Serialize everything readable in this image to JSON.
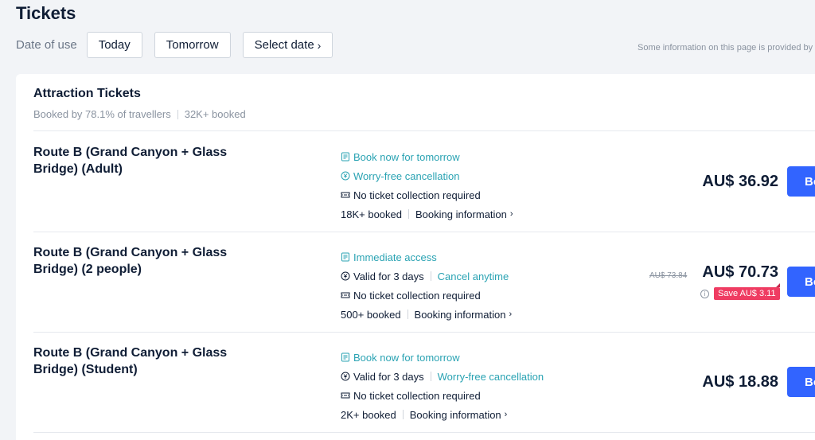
{
  "page": {
    "title": "Tickets",
    "date_label": "Date of use",
    "date_buttons": [
      {
        "label": "Today"
      },
      {
        "label": "Tomorrow"
      },
      {
        "label": "Select date"
      }
    ],
    "notice": "Some information on this page is provided by"
  },
  "card": {
    "title": "Attraction Tickets",
    "booked_by": "Booked by 78.1% of travellers",
    "booked_count": "32K+ booked"
  },
  "tickets": [
    {
      "name": "Route B (Grand Canyon + Glass Bridge) (Adult)",
      "feature1": "Book now for tomorrow",
      "feature2": "Worry-free cancellation",
      "feature3": "No ticket collection required",
      "booked": "18K+ booked",
      "booking_info": "Booking information",
      "price": "AU$ 36.92",
      "book_label": "Book"
    },
    {
      "name": "Route B (Grand Canyon + Glass Bridge) (2 people)",
      "feature1": "Immediate access",
      "validity": "Valid for 3 days",
      "cancel": "Cancel anytime",
      "feature3": "No ticket collection required",
      "booked": "500+ booked",
      "booking_info": "Booking information",
      "original_price": "AU$ 73.84",
      "price": "AU$ 70.73",
      "save": "Save AU$ 3.11",
      "book_label": "Book"
    },
    {
      "name": "Route B (Grand Canyon + Glass Bridge) (Student)",
      "feature1": "Book now for tomorrow",
      "validity": "Valid for 3 days",
      "cancel": "Worry-free cancellation",
      "feature3": "No ticket collection required",
      "booked": "2K+ booked",
      "booking_info": "Booking information",
      "price": "AU$ 18.88",
      "book_label": "Book"
    }
  ],
  "colors": {
    "accent_blue": "#3264ff",
    "teal_link": "#2aa3b3",
    "save_badge": "#ef3c62",
    "page_bg": "#f2f4f7"
  },
  "icons": {
    "calendar": "calendar-icon",
    "cancel": "yen-circle-icon",
    "ticket": "ticket-icon",
    "chevron": "chevron-right-icon",
    "info": "info-icon"
  }
}
